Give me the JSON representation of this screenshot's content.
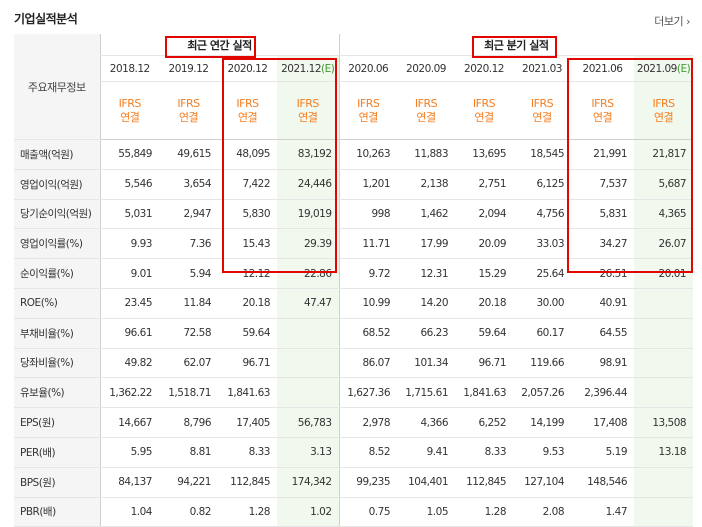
{
  "title": "기업실적분석",
  "more": "더보기",
  "header": {
    "label": "주요재무정보",
    "annual": "최근 연간 실적",
    "quarterly": "최근 분기 실적"
  },
  "periods": [
    {
      "date": "2018.12"
    },
    {
      "date": "2019.12"
    },
    {
      "date": "2020.12"
    },
    {
      "date": "2021.12",
      "est": "(E)"
    },
    {
      "date": "2020.06"
    },
    {
      "date": "2020.09"
    },
    {
      "date": "2020.12"
    },
    {
      "date": "2021.03"
    },
    {
      "date": "2021.06"
    },
    {
      "date": "2021.09",
      "est": "(E)"
    }
  ],
  "ifrs": [
    "IFRS",
    "연결"
  ],
  "rows": [
    {
      "label": "매출액(억원)",
      "values": [
        "55,849",
        "49,615",
        "48,095",
        "83,192",
        "10,263",
        "11,883",
        "13,695",
        "18,545",
        "21,991",
        "21,817"
      ]
    },
    {
      "label": "영업이익(억원)",
      "values": [
        "5,546",
        "3,654",
        "7,422",
        "24,446",
        "1,201",
        "2,138",
        "2,751",
        "6,125",
        "7,537",
        "5,687"
      ]
    },
    {
      "label": "당기순이익(억원)",
      "values": [
        "5,031",
        "2,947",
        "5,830",
        "19,019",
        "998",
        "1,462",
        "2,094",
        "4,756",
        "5,831",
        "4,365"
      ]
    },
    {
      "label": "영업이익률(%)",
      "values": [
        "9.93",
        "7.36",
        "15.43",
        "29.39",
        "11.71",
        "17.99",
        "20.09",
        "33.03",
        "34.27",
        "26.07"
      ]
    },
    {
      "label": "순이익률(%)",
      "values": [
        "9.01",
        "5.94",
        "12.12",
        "22.86",
        "9.72",
        "12.31",
        "15.29",
        "25.64",
        "26.51",
        "20.01"
      ]
    },
    {
      "label": "ROE(%)",
      "values": [
        "23.45",
        "11.84",
        "20.18",
        "47.47",
        "10.99",
        "14.20",
        "20.18",
        "30.00",
        "40.91",
        ""
      ]
    },
    {
      "label": "부채비율(%)",
      "values": [
        "96.61",
        "72.58",
        "59.64",
        "",
        "68.52",
        "66.23",
        "59.64",
        "60.17",
        "64.55",
        ""
      ]
    },
    {
      "label": "당좌비율(%)",
      "values": [
        "49.82",
        "62.07",
        "96.71",
        "",
        "86.07",
        "101.34",
        "96.71",
        "119.66",
        "98.91",
        ""
      ]
    },
    {
      "label": "유보율(%)",
      "values": [
        "1,362.22",
        "1,518.71",
        "1,841.63",
        "",
        "1,627.36",
        "1,715.61",
        "1,841.63",
        "2,057.26",
        "2,396.44",
        ""
      ]
    },
    {
      "label": "EPS(원)",
      "values": [
        "14,667",
        "8,796",
        "17,405",
        "56,783",
        "2,978",
        "4,366",
        "6,252",
        "14,199",
        "17,408",
        "13,508"
      ]
    },
    {
      "label": "PER(배)",
      "values": [
        "5.95",
        "8.81",
        "8.33",
        "3.13",
        "8.52",
        "9.41",
        "8.33",
        "9.53",
        "5.19",
        "13.18"
      ]
    },
    {
      "label": "BPS(원)",
      "values": [
        "84,137",
        "94,221",
        "112,845",
        "174,342",
        "99,235",
        "104,401",
        "112,845",
        "127,104",
        "148,546",
        ""
      ]
    },
    {
      "label": "PBR(배)",
      "values": [
        "1.04",
        "0.82",
        "1.28",
        "1.02",
        "0.75",
        "1.05",
        "1.28",
        "2.08",
        "1.47",
        ""
      ]
    }
  ],
  "colors": {
    "accent_orange": "#f57d20",
    "highlight_red": "#e10600",
    "estimate_green": "#3f9b2f",
    "estimate_bg": "#f1f8ee"
  }
}
